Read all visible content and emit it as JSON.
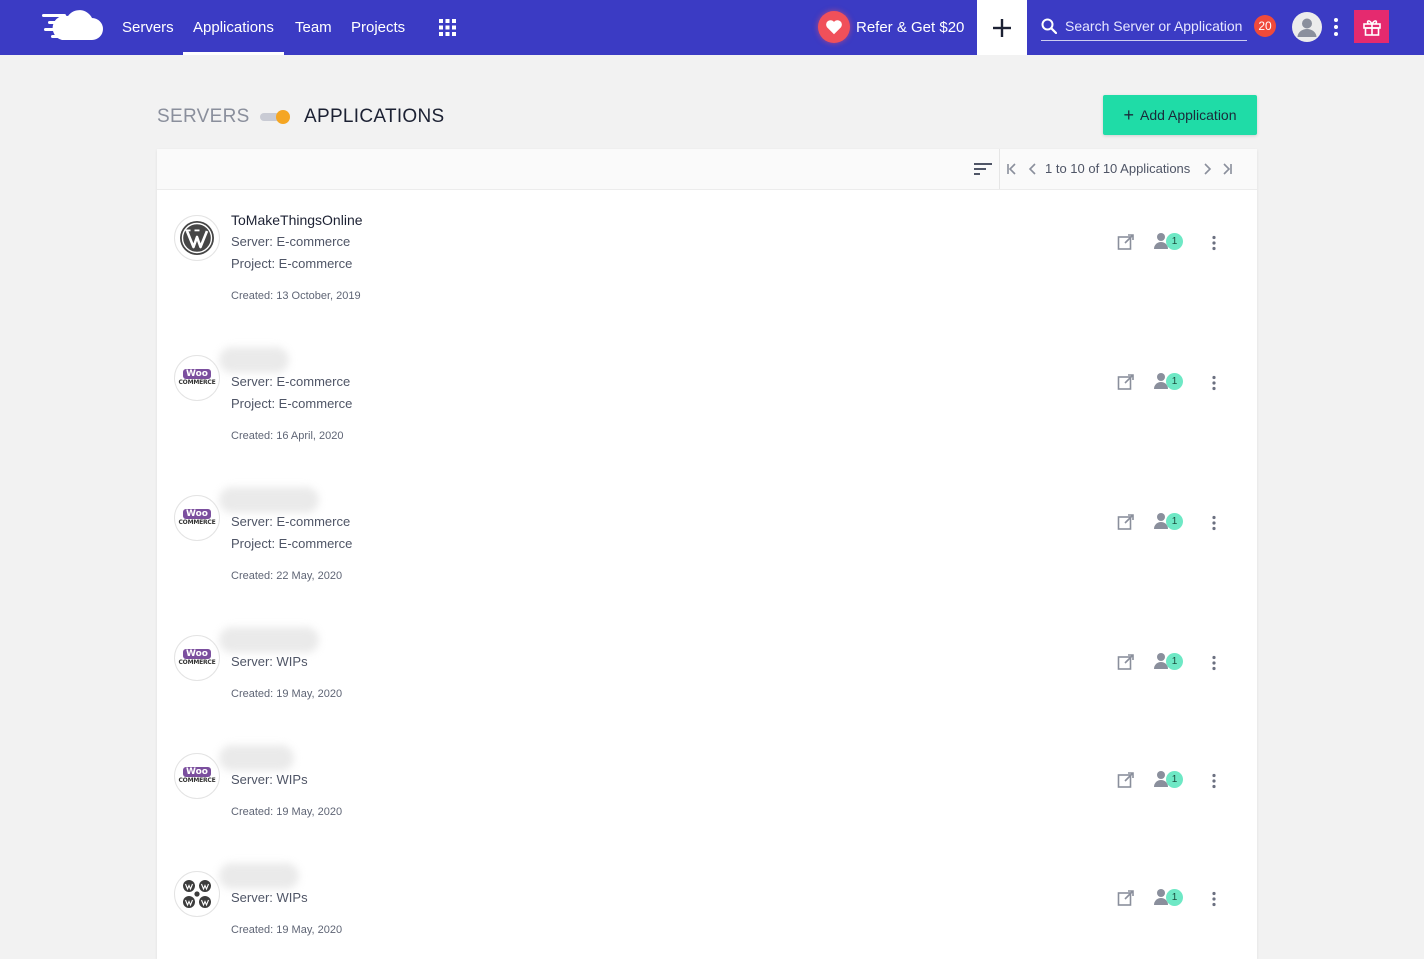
{
  "topbar": {
    "nav": [
      {
        "label": "Servers",
        "active": false
      },
      {
        "label": "Applications",
        "active": true
      },
      {
        "label": "Team",
        "active": false
      },
      {
        "label": "Projects",
        "active": false
      }
    ],
    "refer_label": "Refer & Get $20",
    "search_placeholder": "Search Server or Application",
    "notification_count": "20"
  },
  "header": {
    "servers_label": "SERVERS",
    "applications_label": "APPLICATIONS",
    "add_button_label": "Add Application"
  },
  "pagination": {
    "text": "1 to 10 of 10 Applications"
  },
  "applications": [
    {
      "name": "ToMakeThingsOnline",
      "logo": "wordpress-icon",
      "server": "Server: E-commerce",
      "project": "Project: E-commerce",
      "created": "Created: 13 October, 2019",
      "members": "1"
    },
    {
      "name": "",
      "logo": "woocommerce-icon",
      "server": "Server: E-commerce",
      "project": "Project: E-commerce",
      "created": "Created: 16 April, 2020",
      "members": "1"
    },
    {
      "name": "",
      "logo": "woocommerce-icon",
      "server": "Server: E-commerce",
      "project": "Project: E-commerce",
      "created": "Created: 22 May, 2020",
      "members": "1"
    },
    {
      "name": "",
      "logo": "woocommerce-icon",
      "server": "Server: WIPs",
      "project": "",
      "created": "Created: 19 May, 2020",
      "members": "1"
    },
    {
      "name": "",
      "logo": "woocommerce-icon",
      "server": "Server: WIPs",
      "project": "",
      "created": "Created: 19 May, 2020",
      "members": "1"
    },
    {
      "name": "",
      "logo": "wordpress-multisite-icon",
      "server": "Server: WIPs",
      "project": "",
      "created": "Created: 19 May, 2020",
      "members": "1"
    }
  ],
  "colors": {
    "topbar": "#3b3bc4",
    "accent_button": "#1fdca7",
    "notification": "#f04a3a",
    "gift": "#e52a6f",
    "toggle_knob": "#f5a623",
    "member_badge": "#6ee8c5"
  }
}
